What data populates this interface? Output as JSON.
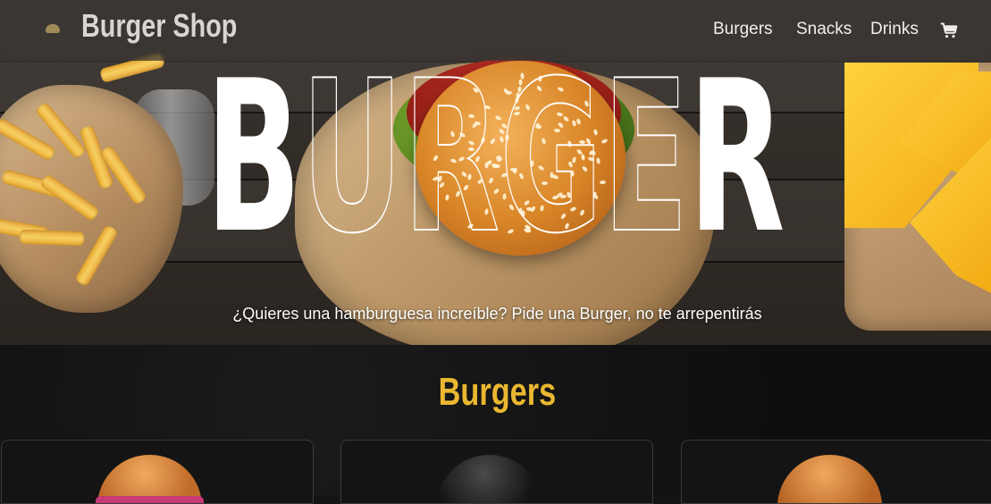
{
  "navbar": {
    "brand": "Burger Shop",
    "links": [
      "Burgers",
      "Snacks",
      "Drinks"
    ],
    "cart_icon": "cart-icon"
  },
  "hero": {
    "title": "BURGER",
    "subtitle": "¿Quieres una hamburguesa increíble? Pide una Burger, no te arrepentirás"
  },
  "section": {
    "title": "Burgers",
    "title_color": "#eab830",
    "cards": [
      {
        "image": "burger-with-pink-sauce"
      },
      {
        "image": "black-bun-burger"
      },
      {
        "image": "sesame-bun-burger"
      }
    ]
  }
}
